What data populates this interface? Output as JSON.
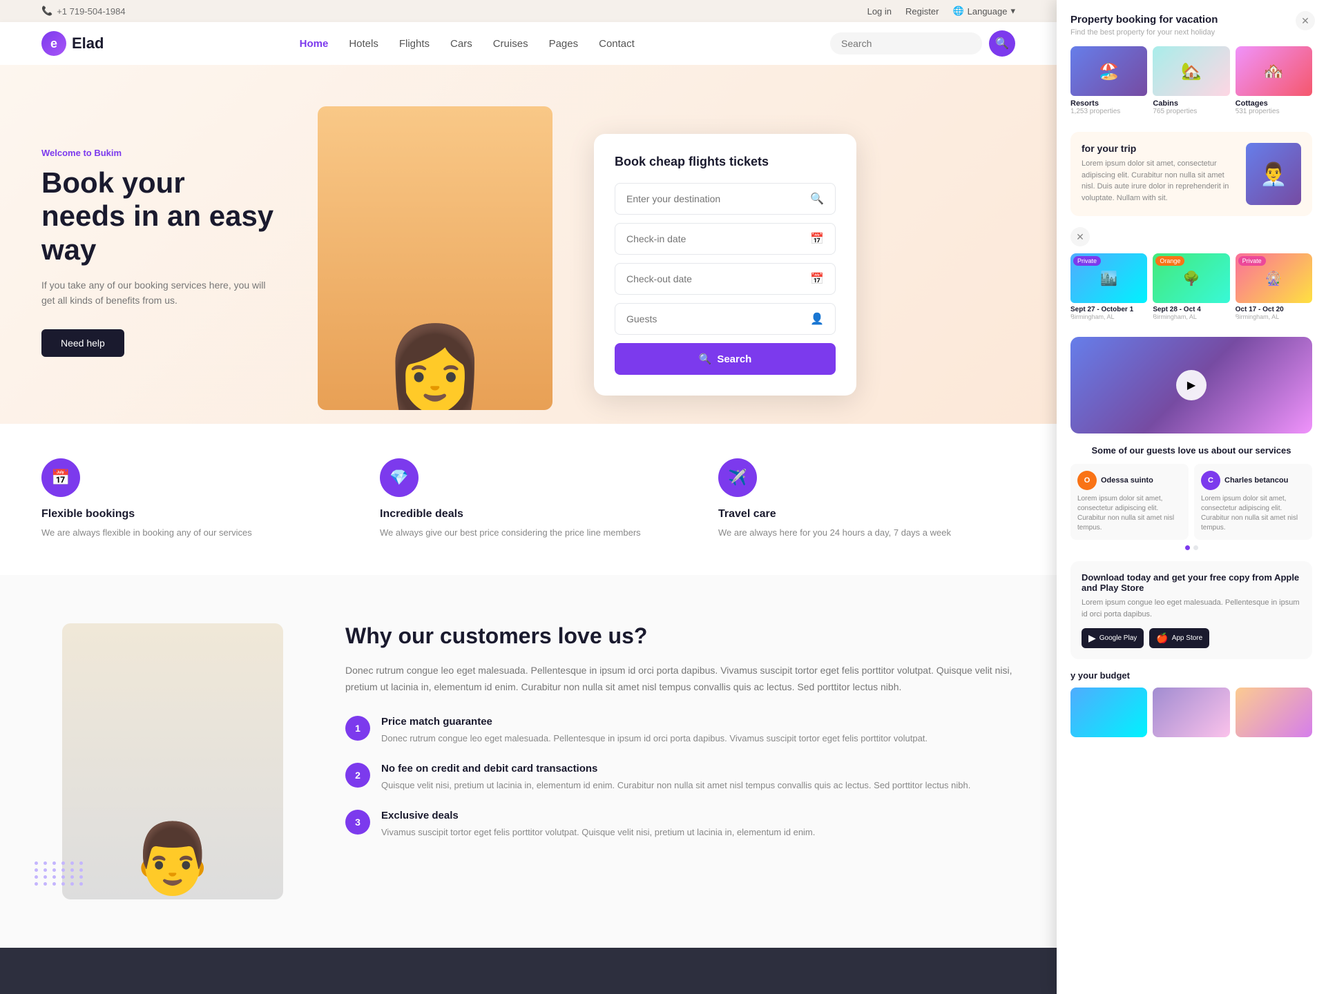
{
  "topbar": {
    "phone": "+1 719-504-1984",
    "login": "Log in",
    "register": "Register",
    "language": "Language"
  },
  "nav": {
    "logo_text": "Elad",
    "logo_letter": "e",
    "links": [
      {
        "label": "Home",
        "active": true
      },
      {
        "label": "Hotels",
        "active": false
      },
      {
        "label": "Flights",
        "active": false
      },
      {
        "label": "Cars",
        "active": false
      },
      {
        "label": "Cruises",
        "active": false
      },
      {
        "label": "Pages",
        "active": false
      },
      {
        "label": "Contact",
        "active": false
      }
    ],
    "search_placeholder": "Search"
  },
  "hero": {
    "tag": "Welcome to Bukim",
    "title": "Book your needs in an easy way",
    "description": "If you take any of our booking services here, you will get all kinds of benefits from us.",
    "cta": "Need help",
    "booking_card": {
      "title": "Book cheap flights tickets",
      "destination_placeholder": "Enter your destination",
      "checkin_placeholder": "Check-in date",
      "checkout_placeholder": "Check-out date",
      "guests_placeholder": "Guests",
      "search_btn": "Search"
    }
  },
  "features": [
    {
      "icon": "📅",
      "title": "Flexible bookings",
      "description": "We are always flexible in booking any of our services"
    },
    {
      "icon": "💎",
      "title": "Incredible deals",
      "description": "We always give our best price considering the price line members"
    },
    {
      "icon": "✈️",
      "title": "Travel care",
      "description": "We are always here for you 24 hours a day, 7 days a week"
    }
  ],
  "why": {
    "title": "Why our customers love us?",
    "description": "Donec rutrum congue leo eget malesuada. Pellentesque in ipsum id orci porta dapibus. Vivamus suscipit tortor eget felis porttitor volutpat. Quisque velit nisi, pretium ut lacinia in, elementum id enim. Curabitur non nulla sit amet nisl tempus convallis quis ac lectus. Sed porttitor lectus nibh.",
    "items": [
      {
        "number": "1",
        "title": "Price match guarantee",
        "description": "Donec rutrum congue leo eget malesuada. Pellentesque in ipsum id orci porta dapibus. Vivamus suscipit tortor eget felis porttitor volutpat."
      },
      {
        "number": "2",
        "title": "No fee on credit and debit card transactions",
        "description": "Quisque velit nisi, pretium ut lacinia in, elementum id enim. Curabitur non nulla sit amet nisl tempus convallis quis ac lectus. Sed porttitor lectus nibh."
      },
      {
        "number": "3",
        "title": "Exclusive deals",
        "description": "Vivamus suscipit tortor eget felis porttitor volutpat. Quisque velit nisi, pretium ut lacinia in, elementum id enim."
      }
    ]
  },
  "right_panel": {
    "property_section": {
      "title": "Property booking for vacation",
      "subtitle": "Find the best property for your next holiday",
      "properties": [
        {
          "label": "Resorts",
          "count": "1,253 properties",
          "emoji": "🏖️"
        },
        {
          "label": "Cabins",
          "count": "765 properties",
          "emoji": "🏡"
        },
        {
          "label": "Cottages",
          "count": "531 properties",
          "emoji": "🏘️"
        }
      ]
    },
    "trip_section": {
      "title": "for your trip",
      "description": "Lorem ipsum dolor sit amet, consectetur adipiscing elit. Curabitur non nulla sit amet nisl. Duis aute irure dolor in reprehenderit in voluptate. Nullam with sit."
    },
    "destinations": [
      {
        "label": "Sept 27 - October 1",
        "sub": "Birmingham, AL",
        "badge": "Private",
        "type": "city"
      },
      {
        "label": "Sept 28 - Oct 4",
        "sub": "Birmingham, AL",
        "badge": "Orange",
        "type": "nature"
      },
      {
        "label": "Oct 17 - Oct 20",
        "sub": "Birmingham, AL",
        "badge": "Private",
        "type": "night"
      }
    ],
    "testimonials": {
      "title": "Some of our guests love us about our services",
      "reviews": [
        {
          "name": "Odessa suinto",
          "avatar_color": "#f97316",
          "text": "Lorem ipsum dolor sit amet, consectetur adipiscing elit. Curabitur non nulla sit amet nisl tempus."
        },
        {
          "name": "Charles betancou",
          "avatar_color": "#7c3aed",
          "text": "Lorem ipsum dolor sit amet, consectetur adipiscing elit. Curabitur non nulla sit amet nisl tempus."
        }
      ]
    },
    "app_section": {
      "title": "Download today and get your free copy from Apple and Play Store",
      "description": "Lorem ipsum congue leo eget malesuada. Pellentesque in ipsum id orci porta dapibus.",
      "google_play": "Google Play",
      "app_store": "App Store"
    },
    "budget_section": {
      "title": "y your budget"
    }
  }
}
